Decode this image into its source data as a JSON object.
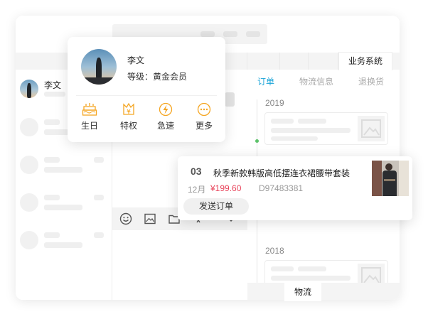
{
  "header": {
    "biz_tab_label": "业务系统"
  },
  "contacts": [
    {
      "name": "李文"
    }
  ],
  "profile_card": {
    "name": "李文",
    "level": "等级：黄金会员",
    "actions": [
      {
        "label": "生日",
        "icon": "birthday-cake-icon"
      },
      {
        "label": "特权",
        "icon": "privilege-icon"
      },
      {
        "label": "急速",
        "icon": "lightning-icon"
      },
      {
        "label": "更多",
        "icon": "more-icon"
      }
    ],
    "accent_color": "#f5a623"
  },
  "right_pane": {
    "tabs": [
      {
        "label": "订单",
        "active": true
      },
      {
        "label": "物流信息",
        "active": false
      },
      {
        "label": "退换货",
        "active": false
      }
    ],
    "years": [
      "2019",
      "2018"
    ],
    "active_color": "#1aa4d8",
    "bottom_tab_label": "物流"
  },
  "product_card": {
    "index": "03",
    "title": "秋季新款韩版高低摆连衣裙腰带套装",
    "month": "12月",
    "price": "¥199.60",
    "sku": "D97483381",
    "send_button": "发送订单",
    "price_color": "#e8435a"
  },
  "toolbar_icons": [
    "emoji-icon",
    "image-icon",
    "folder-icon",
    "scissors-icon",
    "chevron-down-icon"
  ]
}
